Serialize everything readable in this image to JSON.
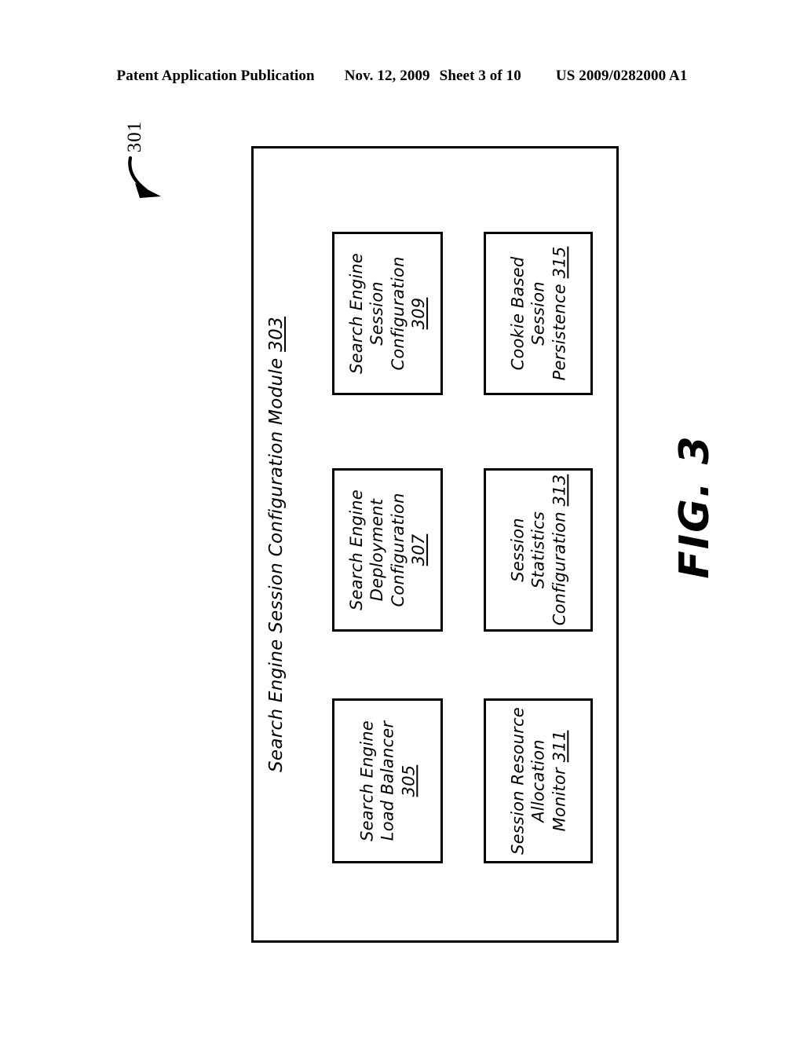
{
  "header": {
    "publication": "Patent Application Publication",
    "date": "Nov. 12, 2009",
    "sheet": "Sheet 3 of 10",
    "patent_number": "US 2009/0282000 A1"
  },
  "figure": {
    "caption": "FIG. 3",
    "reference_numeral": "301",
    "module": {
      "title_text": "Search Engine Session Configuration Module ",
      "title_numeral": "303"
    },
    "components": [
      {
        "id": "309",
        "lines": [
          "Search Engine",
          "Session",
          "Configuration"
        ],
        "numeral": "309",
        "numeral_inline": false
      },
      {
        "id": "315",
        "lines": [
          "Cookie Based",
          "Session",
          "Persistence "
        ],
        "numeral": "315",
        "numeral_inline": true
      },
      {
        "id": "307",
        "lines": [
          "Search Engine",
          "Deployment",
          "Configuration"
        ],
        "numeral": "307",
        "numeral_inline": false
      },
      {
        "id": "313",
        "lines": [
          "Session",
          "Statistics",
          "Configuration "
        ],
        "numeral": "313",
        "numeral_inline": true
      },
      {
        "id": "305",
        "lines": [
          "Search Engine",
          "Load Balancer"
        ],
        "numeral": "305",
        "numeral_inline": false
      },
      {
        "id": "311",
        "lines": [
          "Session Resource",
          "Allocation",
          "Monitor "
        ],
        "numeral": "311",
        "numeral_inline": true
      }
    ]
  },
  "colors": {
    "ink": "#000000",
    "paper": "#ffffff"
  }
}
